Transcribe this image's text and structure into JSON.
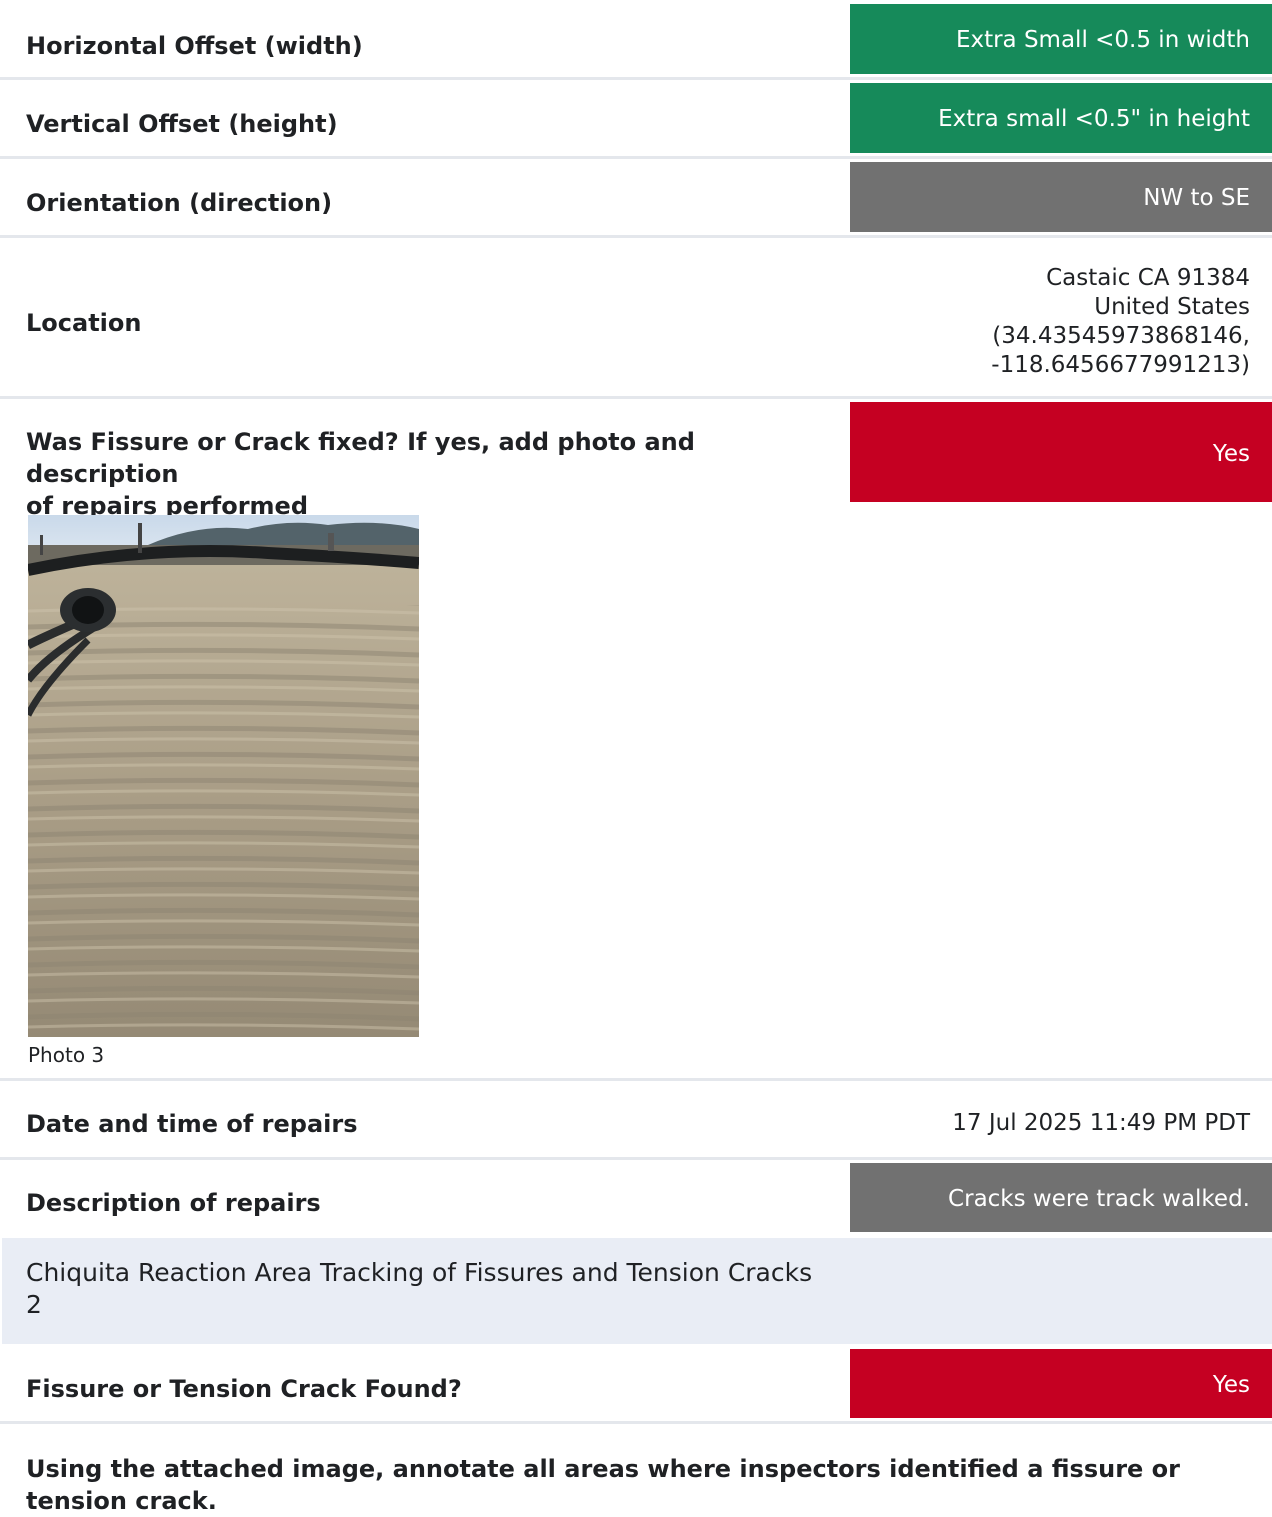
{
  "fields": {
    "horizontal_offset": {
      "label": "Horizontal Offset (width)",
      "value": "Extra Small <0.5 in width",
      "color": "#168a5a"
    },
    "vertical_offset": {
      "label": "Vertical Offset (height)",
      "value": "Extra small <0.5\" in height",
      "color": "#168a5a"
    },
    "orientation": {
      "label": "Orientation (direction)",
      "value": "NW to SE",
      "color": "#717171"
    },
    "location": {
      "label": "Location",
      "lines": [
        "Castaic CA 91384",
        "United States",
        "(34.43545973868146,",
        "-118.6456677991213)"
      ]
    },
    "fixed": {
      "label_line1": "Was Fissure or Crack fixed? If yes, add photo and description",
      "label_line2": "of repairs performed",
      "value": "Yes",
      "color": "#c50022"
    },
    "photo": {
      "caption": "Photo 3"
    },
    "repair_datetime": {
      "label": "Date and time of repairs",
      "value": "17 Jul 2025 11:49 PM PDT"
    },
    "repair_description": {
      "label": "Description of repairs",
      "value": "Cracks were track walked.",
      "color": "#717171"
    }
  },
  "section": {
    "title_line1": "Chiquita Reaction Area Tracking of Fissures and Tension Cracks",
    "title_line2": "2"
  },
  "section_fields": {
    "found": {
      "label": "Fissure or Tension Crack Found?",
      "value": "Yes",
      "color": "#c50022"
    },
    "annotate": {
      "label_line1": "Using the attached image, annotate all areas where inspectors identified a fissure or",
      "label_line2": "tension crack."
    }
  }
}
